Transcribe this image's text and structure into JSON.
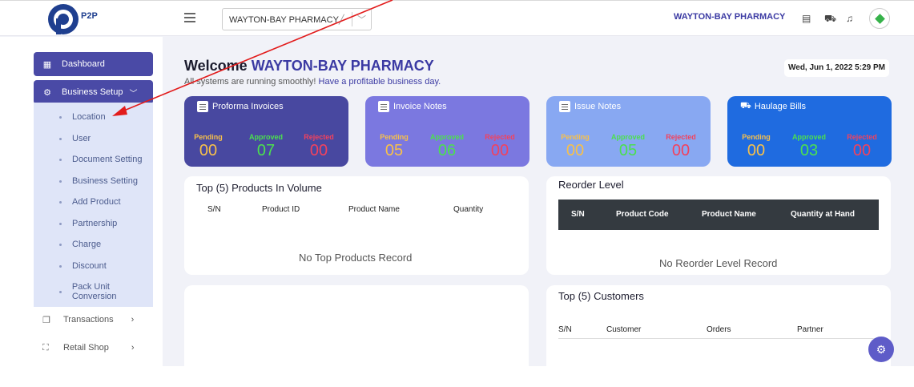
{
  "brand": {
    "logo_text": "P2P"
  },
  "topbar": {
    "store_select_value": "WAYTON-BAY PHARMACY",
    "store_name": "WAYTON-BAY PHARMACY"
  },
  "sidebar": {
    "dashboard": "Dashboard",
    "business_setup": "Business Setup",
    "sub_items": [
      "Location",
      "User",
      "Document Setting",
      "Business Setting",
      "Add Product",
      "Partnership",
      "Charge",
      "Discount",
      "Pack Unit Conversion"
    ],
    "transactions": "Transactions",
    "retail_shop": "Retail Shop"
  },
  "welcome": {
    "prefix": "Welcome",
    "name": "WAYTON-BAY PHARMACY",
    "sub_plain": "All systems are running smoothly!",
    "sub_highlight": "Have a profitable business day.",
    "date": "Wed, Jun 1, 2022 5:29 PM"
  },
  "cards": [
    {
      "title": "Proforma Invoices",
      "color": "#4848a0",
      "pending": "00",
      "approved": "07",
      "rejected": "00"
    },
    {
      "title": "Invoice Notes",
      "color": "#7b78e0",
      "pending": "05",
      "approved": "06",
      "rejected": "00"
    },
    {
      "title": "Issue Notes",
      "color": "#88a8f2",
      "pending": "00",
      "approved": "05",
      "rejected": "00"
    },
    {
      "title": "Haulage Bills",
      "color": "#1f6be0",
      "pending": "00",
      "approved": "03",
      "rejected": "00"
    }
  ],
  "status_labels": {
    "pending": "Pending",
    "approved": "Approved",
    "rejected": "Rejected"
  },
  "top_products": {
    "title": "Top (5) Products In Volume",
    "columns": [
      "S/N",
      "Product ID",
      "Product Name",
      "Quantity"
    ],
    "empty": "No Top Products Record"
  },
  "reorder": {
    "title": "Reorder Level",
    "columns": [
      "S/N",
      "Product Code",
      "Product Name",
      "Quantity at Hand"
    ],
    "empty": "No Reorder Level Record"
  },
  "top_customers": {
    "title": "Top (5) Customers",
    "columns": [
      "S/N",
      "Customer",
      "Orders",
      "Partner"
    ]
  }
}
